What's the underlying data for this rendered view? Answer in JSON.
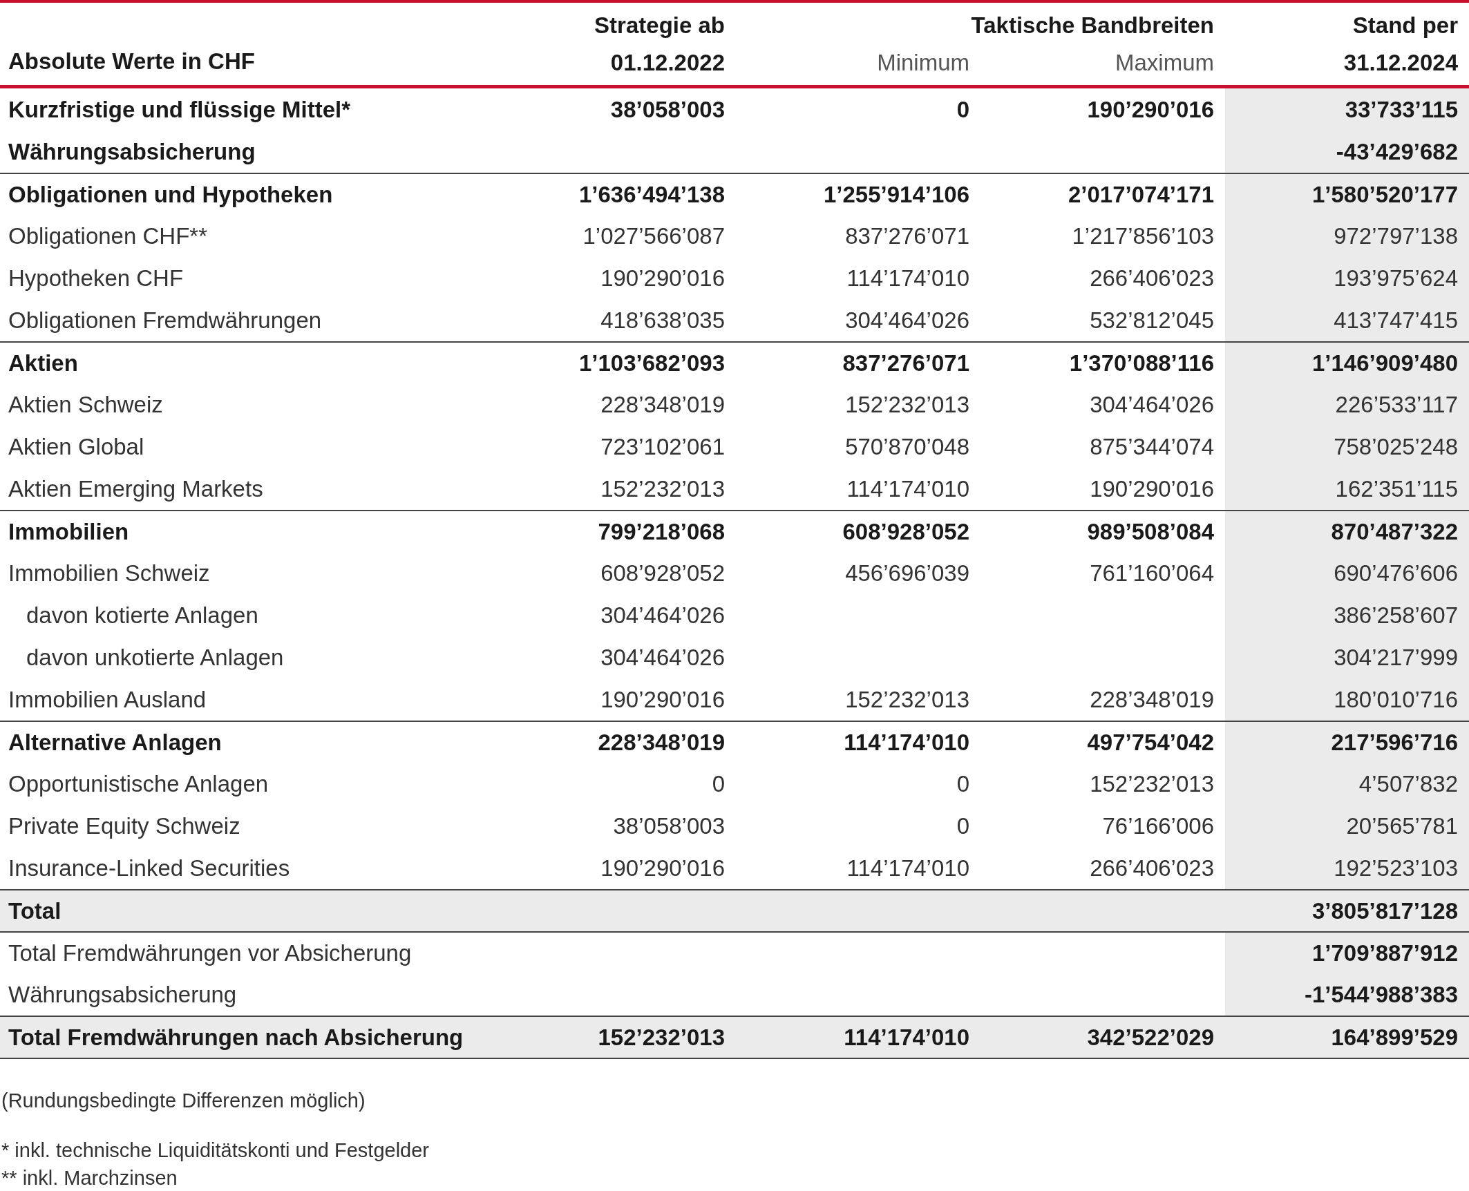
{
  "header": {
    "row_label": "Absolute Werte in CHF",
    "strategy": [
      "Strategie ab",
      "01.12.2022"
    ],
    "band_title": "Taktische Bandbreiten",
    "band_min": "Minimum",
    "band_max": "Maximum",
    "stand": [
      "Stand per",
      "31.12.2024"
    ]
  },
  "rows": [
    {
      "kind": "group",
      "rule_above": false,
      "label": "Kurzfristige und flüssige Mittel*",
      "values": {
        "strategy": "38’058’003",
        "minimum": "0",
        "maximum": "190’290’016",
        "stand": "33’733’115"
      }
    },
    {
      "kind": "group",
      "rule_above": false,
      "label": "Währungsabsicherung",
      "values": {
        "stand": "-43’429’682"
      }
    },
    {
      "kind": "group",
      "rule_above": true,
      "label": "Obligationen und Hypotheken",
      "values": {
        "strategy": "1’636’494’138",
        "minimum": "1’255’914’106",
        "maximum": "2’017’074’171",
        "stand": "1’580’520’177"
      }
    },
    {
      "kind": "item",
      "rule_above": false,
      "label": "Obligationen CHF**",
      "values": {
        "strategy": "1’027’566’087",
        "minimum": "837’276’071",
        "maximum": "1’217’856’103",
        "stand": "972’797’138"
      }
    },
    {
      "kind": "item",
      "rule_above": false,
      "label": "Hypotheken CHF",
      "values": {
        "strategy": "190’290’016",
        "minimum": "114’174’010",
        "maximum": "266’406’023",
        "stand": "193’975’624"
      }
    },
    {
      "kind": "item",
      "rule_above": false,
      "label": "Obligationen Fremdwährungen",
      "values": {
        "strategy": "418’638’035",
        "minimum": "304’464’026",
        "maximum": "532’812’045",
        "stand": "413’747’415"
      }
    },
    {
      "kind": "group",
      "rule_above": true,
      "label": "Aktien",
      "values": {
        "strategy": "1’103’682’093",
        "minimum": "837’276’071",
        "maximum": "1’370’088’116",
        "stand": "1’146’909’480"
      }
    },
    {
      "kind": "item",
      "rule_above": false,
      "label": "Aktien Schweiz",
      "values": {
        "strategy": "228’348’019",
        "minimum": "152’232’013",
        "maximum": "304’464’026",
        "stand": "226’533’117"
      }
    },
    {
      "kind": "item",
      "rule_above": false,
      "label": "Aktien Global",
      "values": {
        "strategy": "723’102’061",
        "minimum": "570’870’048",
        "maximum": "875’344’074",
        "stand": "758’025’248"
      }
    },
    {
      "kind": "item",
      "rule_above": false,
      "label": "Aktien Emerging Markets",
      "values": {
        "strategy": "152’232’013",
        "minimum": "114’174’010",
        "maximum": "190’290’016",
        "stand": "162’351’115"
      }
    },
    {
      "kind": "group",
      "rule_above": true,
      "label": "Immobilien",
      "values": {
        "strategy": "799’218’068",
        "minimum": "608’928’052",
        "maximum": "989’508’084",
        "stand": "870’487’322"
      }
    },
    {
      "kind": "item",
      "rule_above": false,
      "label": "Immobilien Schweiz",
      "values": {
        "strategy": "608’928’052",
        "minimum": "456’696’039",
        "maximum": "761’160’064",
        "stand": "690’476’606"
      }
    },
    {
      "kind": "sub",
      "rule_above": false,
      "label": "davon kotierte Anlagen",
      "values": {
        "strategy": "304’464’026",
        "stand": "386’258’607"
      }
    },
    {
      "kind": "sub",
      "rule_above": false,
      "label": "davon unkotierte Anlagen",
      "values": {
        "strategy": "304’464’026",
        "stand": "304’217’999"
      }
    },
    {
      "kind": "item",
      "rule_above": false,
      "label": "Immobilien Ausland",
      "values": {
        "strategy": "190’290’016",
        "minimum": "152’232’013",
        "maximum": "228’348’019",
        "stand": "180’010’716"
      }
    },
    {
      "kind": "group",
      "rule_above": true,
      "label": "Alternative Anlagen",
      "values": {
        "strategy": "228’348’019",
        "minimum": "114’174’010",
        "maximum": "497’754’042",
        "stand": "217’596’716"
      }
    },
    {
      "kind": "item",
      "rule_above": false,
      "label": "Opportunistische Anlagen",
      "values": {
        "strategy": "0",
        "minimum": "0",
        "maximum": "152’232’013",
        "stand": "4’507’832"
      }
    },
    {
      "kind": "item",
      "rule_above": false,
      "label": "Private Equity Schweiz",
      "values": {
        "strategy": "38’058’003",
        "minimum": "0",
        "maximum": "76’166’006",
        "stand": "20’565’781"
      }
    },
    {
      "kind": "item",
      "rule_above": false,
      "label": "Insurance-Linked Securities",
      "values": {
        "strategy": "190’290’016",
        "minimum": "114’174’010",
        "maximum": "266’406’023",
        "stand": "192’523’103"
      }
    },
    {
      "kind": "total",
      "rule_above": true,
      "label": "Total",
      "values": {
        "stand": "3’805’817’128"
      }
    },
    {
      "kind": "memo",
      "rule_above": true,
      "label": "Total Fremdwährungen vor Absicherung",
      "values": {
        "stand": "1’709’887’912"
      }
    },
    {
      "kind": "memo",
      "rule_above": false,
      "label": "Währungsabsicherung",
      "values": {
        "stand": "-1’544’988’383"
      }
    },
    {
      "kind": "total",
      "rule_above": true,
      "label": "Total Fremdwährungen nach Absicherung",
      "values": {
        "strategy": "152’232’013",
        "minimum": "114’174’010",
        "maximum": "342’522’029",
        "stand": "164’899’529"
      }
    }
  ],
  "notes": [
    "(Rundungsbedingte Differenzen möglich)",
    "* inkl. technische Liquiditätskonti und Festgelder",
    "** inkl. Marchzinsen"
  ]
}
